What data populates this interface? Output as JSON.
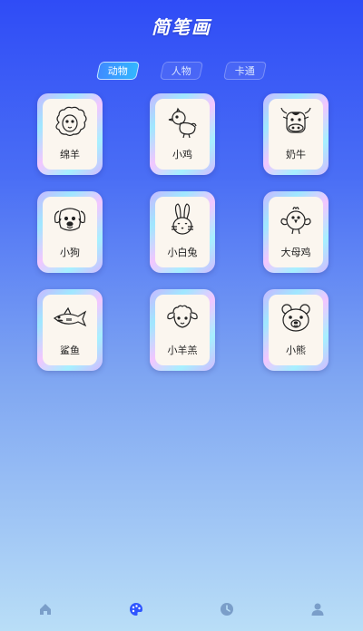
{
  "header": {
    "title": "简笔画"
  },
  "tabs": [
    {
      "label": "动物",
      "active": true
    },
    {
      "label": "人物",
      "active": false
    },
    {
      "label": "卡通",
      "active": false
    }
  ],
  "cards": [
    {
      "label": "绵羊",
      "icon": "sheep-drawing"
    },
    {
      "label": "小鸡",
      "icon": "chick-drawing"
    },
    {
      "label": "奶牛",
      "icon": "cow-drawing"
    },
    {
      "label": "小狗",
      "icon": "dog-drawing"
    },
    {
      "label": "小白兔",
      "icon": "rabbit-drawing"
    },
    {
      "label": "大母鸡",
      "icon": "hen-drawing"
    },
    {
      "label": "鲨鱼",
      "icon": "shark-drawing"
    },
    {
      "label": "小羊羔",
      "icon": "lamb-drawing"
    },
    {
      "label": "小熊",
      "icon": "bear-drawing"
    }
  ],
  "bottom_nav": [
    {
      "icon": "home-icon",
      "active": false
    },
    {
      "icon": "palette-icon",
      "active": true
    },
    {
      "icon": "clock-icon",
      "active": false
    },
    {
      "icon": "user-icon",
      "active": false
    }
  ],
  "colors": {
    "gradient_top": "#2f4cf6",
    "gradient_bottom": "#b9def7",
    "tab_active": "#3f8bff",
    "nav_active": "#2f56ff",
    "nav_inactive": "#7a9ec9"
  }
}
